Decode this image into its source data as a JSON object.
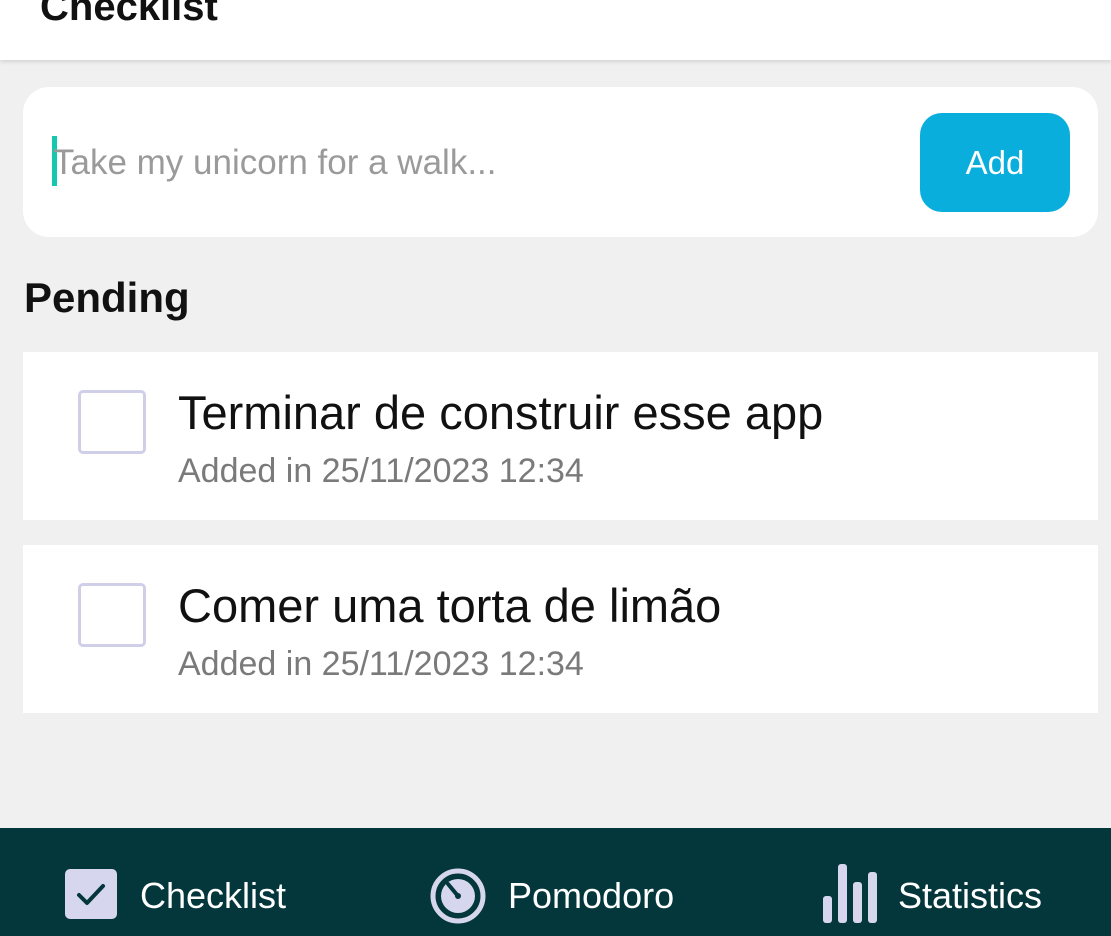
{
  "header": {
    "title": "Checklist"
  },
  "new_task": {
    "placeholder": "Take my unicorn for a walk...",
    "value": "",
    "add_label": "Add"
  },
  "pending": {
    "heading": "Pending",
    "items": [
      {
        "title": "Terminar de construir esse app",
        "date": "Added in 25/11/2023 12:34",
        "checked": false
      },
      {
        "title": "Comer uma torta de limão",
        "date": "Added in 25/11/2023 12:34",
        "checked": false
      }
    ]
  },
  "nav": {
    "items": [
      {
        "label": "Checklist",
        "icon": "checkbox-icon",
        "active": true
      },
      {
        "label": "Pomodoro",
        "icon": "timer-icon",
        "active": false
      },
      {
        "label": "Statistics",
        "icon": "bar-chart-icon",
        "active": false
      }
    ]
  },
  "colors": {
    "accent": "#0aaedc",
    "caret": "#14c8b0",
    "nav_background": "#03373b",
    "background": "#f0f0f0",
    "checkbox_border": "#cfd0e8"
  }
}
